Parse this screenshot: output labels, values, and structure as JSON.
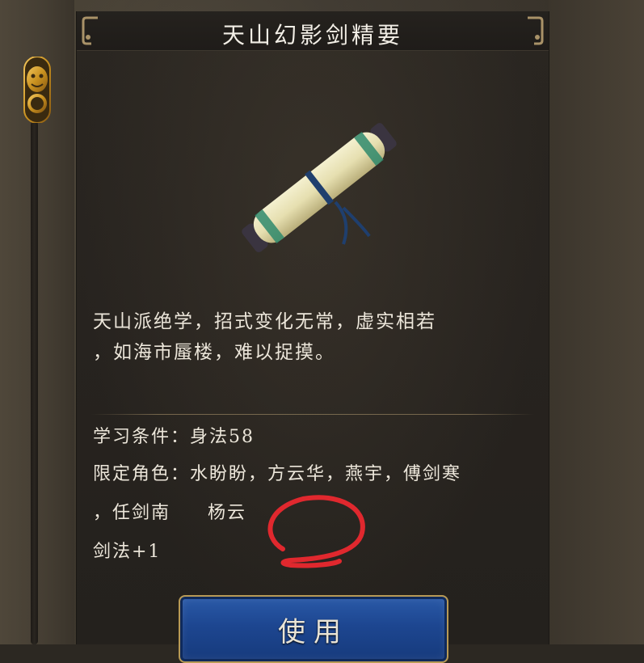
{
  "item": {
    "title": "天山幻影剑精要",
    "description_line1": "天山派绝学，招式变化无常，虚实相若",
    "description_line2": "，如海市蜃楼，难以捉摸。"
  },
  "requirements": {
    "learn_condition": "学习条件：身法58",
    "limited_roles_line1": "限定角色：水盼盼，方云华，燕宇，傅剑寒",
    "limited_roles_line2_part1": "，任剑南",
    "limited_roles_line2_part2": "杨云",
    "effect": "剑法+1"
  },
  "actions": {
    "use_label": "使用"
  },
  "colors": {
    "panel_bg": "#27231f",
    "text": "#ece6da",
    "button_blue": "#1d4690",
    "button_border": "#b89a55",
    "annotation_red": "#e0282e"
  },
  "icons": {
    "emblem": "lion-head-ring-icon",
    "item": "scroll-icon"
  }
}
